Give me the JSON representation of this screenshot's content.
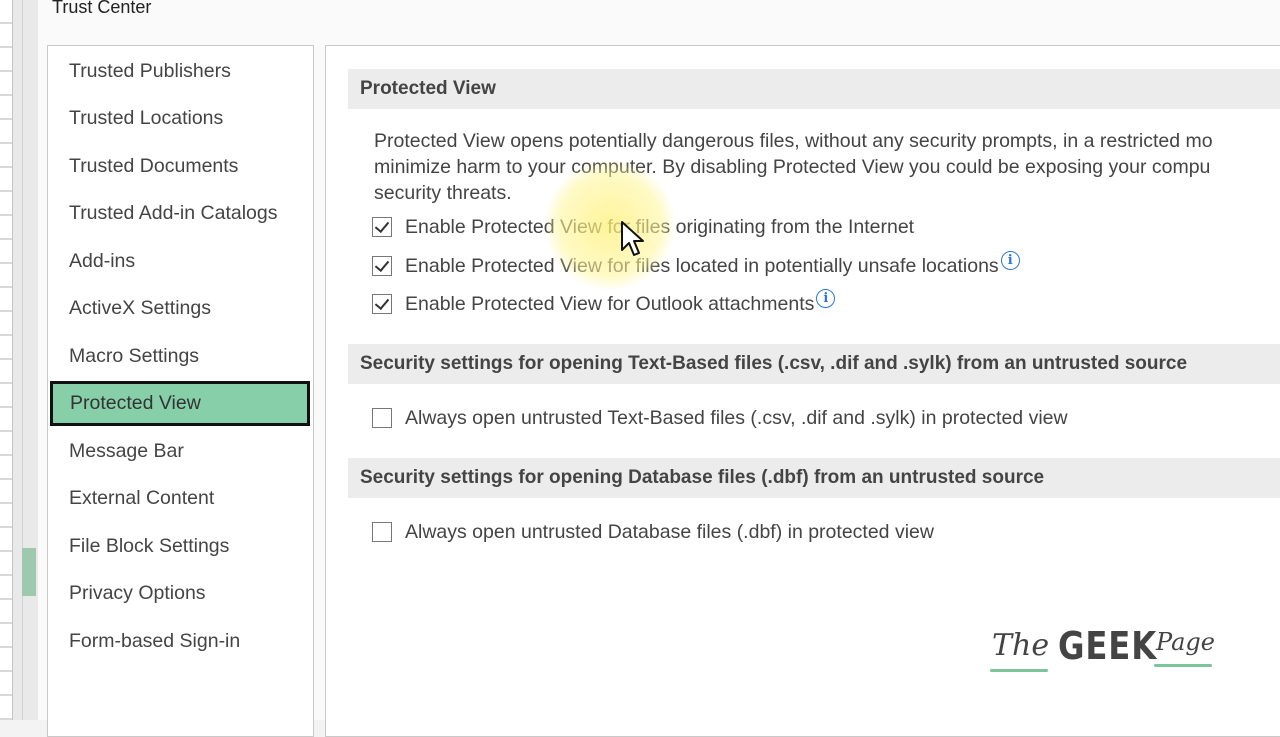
{
  "dialog": {
    "title": "Trust Center"
  },
  "nav": {
    "items": [
      {
        "label": "Trusted Publishers",
        "active": false
      },
      {
        "label": "Trusted Locations",
        "active": false
      },
      {
        "label": "Trusted Documents",
        "active": false
      },
      {
        "label": "Trusted Add-in Catalogs",
        "active": false
      },
      {
        "label": "Add-ins",
        "active": false
      },
      {
        "label": "ActiveX Settings",
        "active": false
      },
      {
        "label": "Macro Settings",
        "active": false
      },
      {
        "label": "Protected View",
        "active": true
      },
      {
        "label": "Message Bar",
        "active": false
      },
      {
        "label": "External Content",
        "active": false
      },
      {
        "label": "File Block Settings",
        "active": false
      },
      {
        "label": "Privacy Options",
        "active": false
      },
      {
        "label": "Form-based Sign-in",
        "active": false
      }
    ],
    "active_color": "#86cfa8"
  },
  "protected_view": {
    "header": "Protected View",
    "description": [
      "Protected View opens potentially dangerous files, without any security prompts, in a restricted mo",
      "minimize harm to your computer. By disabling Protected View you could be exposing your compu",
      "security threats."
    ],
    "options": [
      {
        "label": "Enable Protected View for files originating from the Internet",
        "checked": true,
        "info": false
      },
      {
        "label": "Enable Protected View for files located in potentially unsafe locations",
        "checked": true,
        "info": true
      },
      {
        "label": "Enable Protected View for Outlook attachments",
        "checked": true,
        "info": true
      }
    ]
  },
  "text_files": {
    "header": "Security settings for opening Text-Based files (.csv, .dif and .sylk) from an untrusted source",
    "option": {
      "label": "Always open untrusted Text-Based files (.csv, .dif and .sylk) in protected view",
      "checked": false
    }
  },
  "database_files": {
    "header": "Security settings for opening Database files (.dbf) from an untrusted source",
    "option": {
      "label": "Always open untrusted Database files (.dbf) in protected view",
      "checked": false
    }
  },
  "watermark": {
    "the": "The",
    "geek": "GEEK",
    "page": "Page"
  },
  "icons": {
    "info": "info-icon",
    "check": "checkmark-icon",
    "cursor": "mouse-pointer-icon"
  }
}
